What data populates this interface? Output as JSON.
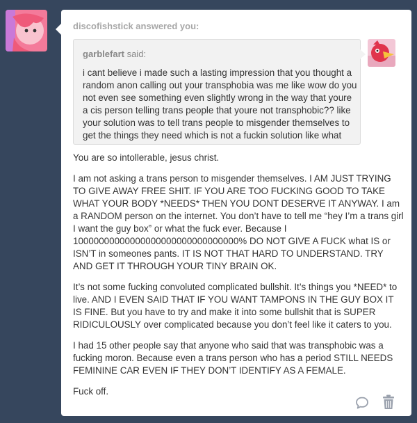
{
  "post": {
    "answerer": "discofishstick answered you:",
    "asker_name": "garblefart",
    "asker_said": " said:",
    "question": "i cant believe i made such a lasting impression that you thought a random anon calling out your transphobia was me like wow do you not even see something even slightly wrong in the way that youre a cis person telling trans people that youre not transphobic?? like your solution was to tell trans people to misgender themselves to get the things they need which is not a fuckin solution like what",
    "answer_paragraphs": [
      "You are so intollerable, jesus christ.",
      "I am not asking a trans person to misgender themselves. I AM JUST TRYING TO GIVE AWAY FREE SHIT. IF YOU ARE TOO FUCKING GOOD TO TAKE WHAT YOUR BODY *NEEDS* THEN YOU DONT DESERVE IT ANYWAY. I am a RANDOM person on the internet. You don’t have to tell me “hey I’m a trans girl I want the guy box” or what the fuck ever. Because I 10000000000000000000000000000000% DO NOT GIVE A FUCK what IS or ISN’T in someones pants. IT IS NOT THAT HARD TO UNDERSTAND. TRY AND GET IT THROUGH YOUR TINY BRAIN OK.",
      "It’s not some fucking convoluted complicated bullshit. It’s things you *NEED* to live. AND I EVEN SAID THAT IF YOU WANT TAMPONS IN THE GUY BOX IT IS FINE. But you have to try and make it into some bullshit that is SUPER RIDICULOUSLY over complicated because you don’t feel like it caters to you.",
      "I had 15 other people say that anyone who said that was transphobic was a fucking moron. Because even a trans person who has a period STILL NEEDS FEMININE CAR EVEN IF THEY DON’T IDENTIFY AS A FEMALE.",
      "Fuck off."
    ]
  },
  "icons": {
    "reply": "speech-bubble-icon",
    "delete": "trash-icon"
  },
  "colors": {
    "background": "#36465d",
    "card": "#ffffff",
    "quote_bg": "#f2f2f2"
  }
}
